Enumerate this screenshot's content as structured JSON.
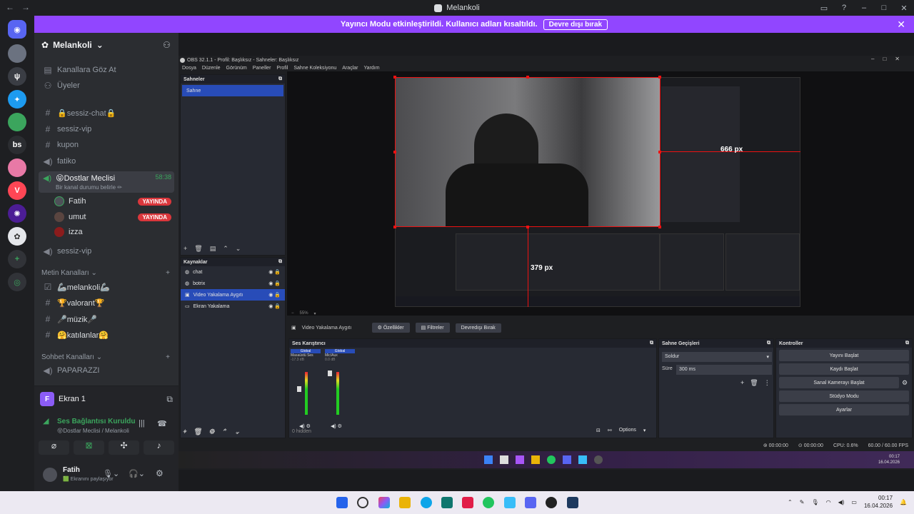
{
  "titlebar": {
    "nav_back": "←",
    "nav_fwd": "→",
    "title": "Melankoli"
  },
  "banner": {
    "text": "Yayıncı Modu etkinleştirildi. Kullanıcı adları kısaltıldı.",
    "button": "Devre dışı bırak"
  },
  "rail": {
    "bs_label": "bs"
  },
  "sidebar": {
    "server_name": "Melankoli",
    "browse_channels": "Kanallara Göz At",
    "members": "Üyeler",
    "channels": [
      {
        "icon": "hash",
        "label": "🔒sessiz-chat🔒"
      },
      {
        "icon": "hash",
        "label": "sessiz-vip"
      },
      {
        "icon": "hash",
        "label": "kupon"
      },
      {
        "icon": "speaker",
        "label": "fatiko"
      }
    ],
    "active_voice": {
      "label": "😝Dostlar Meclisi",
      "timer": "58:38",
      "status": "Bir kanal durumu belirle ✏"
    },
    "voice_users": [
      {
        "name": "Fatih",
        "badge": "YAYINDA"
      },
      {
        "name": "umut",
        "badge": "YAYINDA"
      },
      {
        "name": "izza",
        "badge": ""
      }
    ],
    "after_voice": {
      "label": "sessiz-vip"
    },
    "text_category": "Metin Kanalları ⌄",
    "text_channels": [
      "🦾melankoli🦾",
      "🏆valorant🏆",
      "🎤müzik🎤",
      "🤗katılanlar🤗"
    ],
    "chat_category": "Sohbet Kanalları ⌄",
    "chat_channels": [
      "PAPARAZZI"
    ]
  },
  "voice_panel": {
    "screen_title": "Ekran 1",
    "conn_status": "Ses Bağlantısı Kuruldu",
    "conn_channel": "😝Dostlar Meclisi / Melankoli",
    "user_name": "Fatih",
    "user_status": "🟩 Ekranını paylaşıyor"
  },
  "obs": {
    "title": "OBS 32.1.1 - Profil: Başlıksız - Sahneler: Başlıksız",
    "menu": [
      "Dosya",
      "Düzenle",
      "Görünüm",
      "Paneller",
      "Profil",
      "Sahne Koleksiyonu",
      "Araçlar",
      "Yardım"
    ],
    "scenes_header": "Sahneler",
    "scenes": [
      "Sahne"
    ],
    "sources_header": "Kaynaklar",
    "sources": [
      "chat",
      "botrix",
      "Video Yakalama Aygıtı",
      "Ekran Yakalama"
    ],
    "selected_source": "Video Yakalama Aygıtı",
    "prop_button": "Özellikler",
    "filter_button": "Filtreler",
    "disable_button": "Devredışı Bırak",
    "px_width": "666 px",
    "px_height": "379 px",
    "zoom_text": "55%",
    "mixer_header": "Ses Karıştırıcı",
    "mixer_ch1_tag": "Global",
    "mixer_ch1": "Masaüstü Ses",
    "mixer_ch1_db": "-17.3 dB",
    "mixer_ch2_tag": "Global",
    "mixer_ch2": "Mic/Aux",
    "mixer_ch2_db": "0.0 dB",
    "mixer_hidden": "0 hidden",
    "mixer_options": "Options",
    "transitions_header": "Sahne Geçişleri",
    "transition_type": "Soldur",
    "duration_label": "Süre",
    "duration_value": "300 ms",
    "controls_header": "Kontroller",
    "controls": [
      "Yayını Başlat",
      "Kaydı Başlat",
      "Sanal Kamerayı Başlat",
      "Stüdyo Modu",
      "Ayarlar"
    ],
    "status_stream": "00:00:00",
    "status_rec": "00:00:00",
    "status_cpu": "CPU: 0.6%",
    "status_fps": "60.00 / 60.00 FPS",
    "inner_clock_time": "00:17",
    "inner_clock_date": "16.04.2026"
  },
  "taskbar": {
    "time": "00:17",
    "date": "16.04.2026"
  }
}
